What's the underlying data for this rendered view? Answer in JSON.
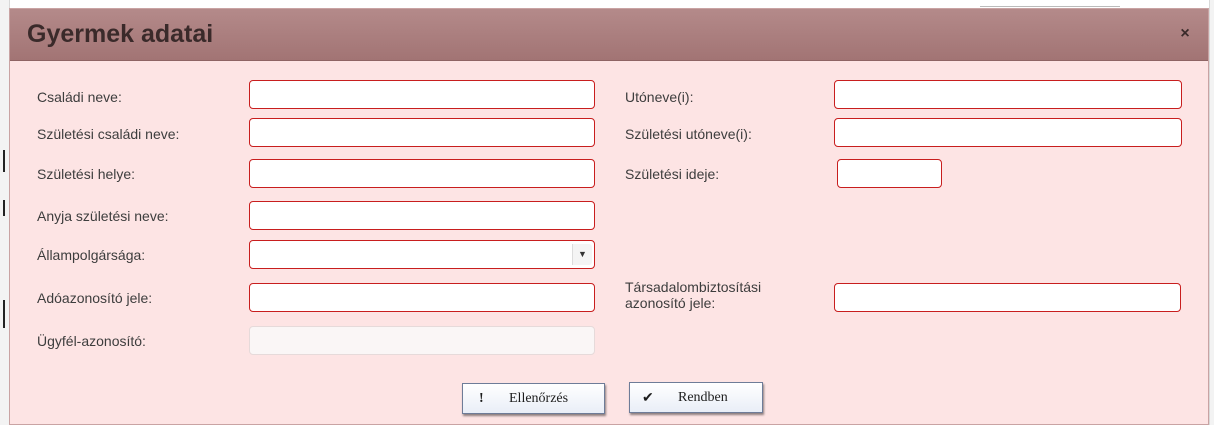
{
  "dialog": {
    "title": "Gyermek adatai",
    "close_glyph": "×"
  },
  "form": {
    "csaladi_neve": {
      "label": "Családi neve:",
      "value": ""
    },
    "utoneve": {
      "label": "Utóneve(i):",
      "value": ""
    },
    "szuletesi_csaladi_neve": {
      "label": "Születési családi neve:",
      "value": ""
    },
    "szuletesi_utoneve": {
      "label": "Születési utóneve(i):",
      "value": ""
    },
    "szuletesi_helye": {
      "label": "Születési helye:",
      "value": ""
    },
    "szuletesi_ideje": {
      "label": "Születési ideje:",
      "value": ""
    },
    "anyja_szuletesi_neve": {
      "label": "Anyja születési neve:",
      "value": ""
    },
    "allampolgarsaga": {
      "label": "Állampolgársága:",
      "value": ""
    },
    "adoazonosito_jele": {
      "label": "Adóazonosító jele:",
      "value": ""
    },
    "taj": {
      "label_line1": "Társadalombiztosítási",
      "label_line2": "azonosító jele:",
      "value": ""
    },
    "ugyfel_azonosito": {
      "label": "Ügyfél-azonosító:",
      "value": ""
    }
  },
  "buttons": {
    "check": {
      "icon": "!",
      "label": "Ellenőrzés"
    },
    "ok": {
      "icon": "✔",
      "label": "Rendben"
    }
  },
  "icons": {
    "dropdown": "▼"
  },
  "colors": {
    "titlebar": "#a27474",
    "dialog_bg": "#fde4e4",
    "field_border": "#c81e1e",
    "button_border": "#6e7c98"
  }
}
